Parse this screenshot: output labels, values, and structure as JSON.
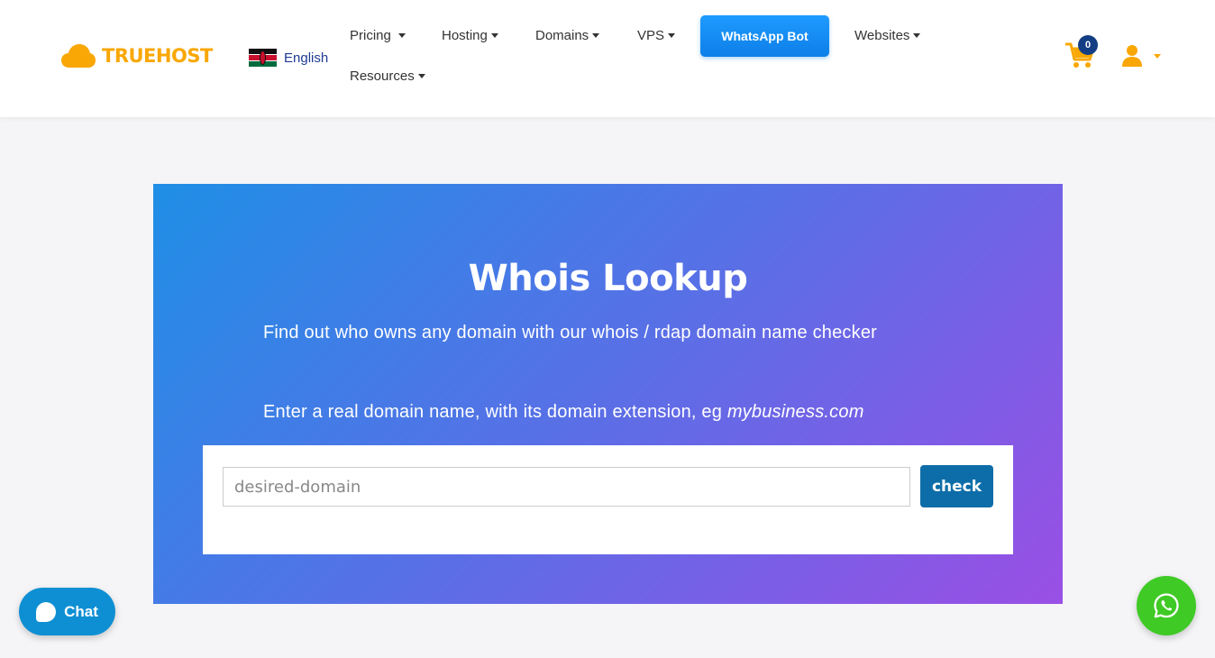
{
  "header": {
    "logo_text": "TRUEHOST",
    "language": "English",
    "nav": [
      {
        "label": "Pricing"
      },
      {
        "label": "Hosting"
      },
      {
        "label": "Domains"
      },
      {
        "label": "VPS"
      },
      {
        "label": "Websites"
      },
      {
        "label": "Resources"
      }
    ],
    "whatsapp_bot_label": "WhatsApp Bot",
    "cart_count": "0"
  },
  "hero": {
    "title": "Whois Lookup",
    "description": "Find out who owns any domain with our whois / rdap domain name checker",
    "hint_prefix": "Enter a real domain name, with its domain extension, eg ",
    "hint_example": "mybusiness.com",
    "search_placeholder": "desired-domain",
    "check_label": "check"
  },
  "chat": {
    "label": "Chat"
  },
  "colors": {
    "brand": "#f9a704",
    "nav_blue": "#1f3a93",
    "whatsapp_button": "#1f9bff",
    "check_button": "#0d6da8",
    "whatsapp_fab": "#3fca25",
    "hero_gradient_start": "#1f8fe6",
    "hero_gradient_end": "#9a4fe5"
  },
  "icons": [
    "cloud-logo-icon",
    "kenya-flag-icon",
    "cart-icon",
    "user-icon",
    "chat-bubble-icon",
    "whatsapp-icon"
  ]
}
